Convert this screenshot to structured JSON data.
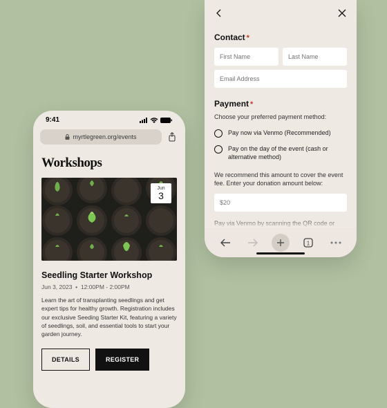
{
  "left": {
    "status_time": "9:41",
    "url": "myrtlegreen.org/events",
    "page_title": "Workshops",
    "date_badge": {
      "month": "Jun",
      "day": "3"
    },
    "event": {
      "title": "Seedling Starter Workshop",
      "date": "Jun 3, 2023",
      "sep": "•",
      "time": "12:00PM - 2:00PM",
      "description": "Learn the art of transplanting seedlings and get expert tips for healthy growth. Registration includes our exclusive Seeding Starter Kit, featuring a variety of seedlings, soil, and essential tools to start your garden journey."
    },
    "buttons": {
      "details": "DETAILS",
      "register": "REGISTER"
    }
  },
  "right": {
    "contact_heading": "Contact",
    "first_name_ph": "First Name",
    "last_name_ph": "Last Name",
    "email_ph": "Email Address",
    "payment_heading": "Payment",
    "payment_hint": "Choose your preferred payment method:",
    "option1": "Pay now via Venmo (Recommended)",
    "option2": "Pay on the day of the event (cash or alternative method)",
    "note": "We recommend this amount to cover the event fee. Enter your donation amount below:",
    "amount_value": "$20",
    "pay_hint_cut": "Pay via Venmo by scanning the QR code or",
    "tab_count": "1"
  }
}
